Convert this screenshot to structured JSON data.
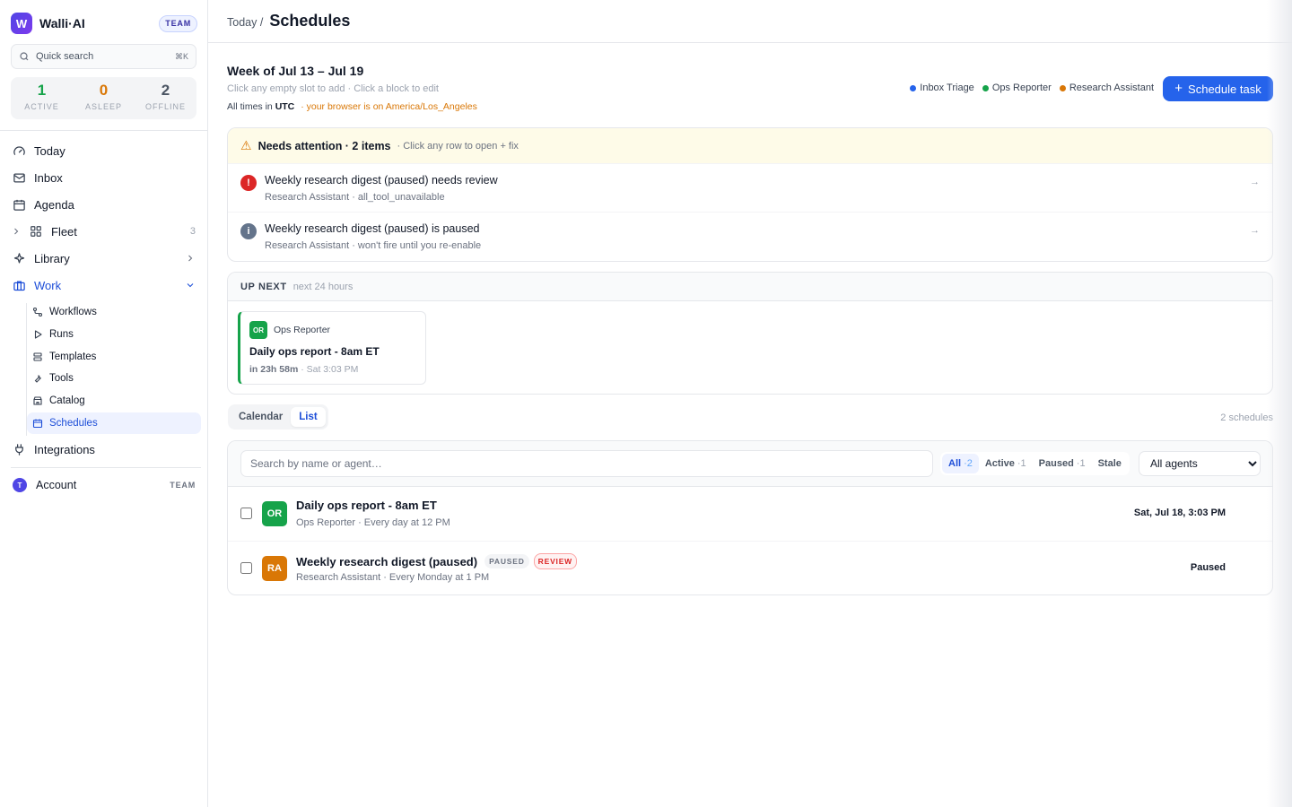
{
  "brand": {
    "logo": "W",
    "name": "Walli·AI",
    "plan": "TEAM"
  },
  "quick_search": {
    "placeholder": "Quick search",
    "shortcut": "⌘K"
  },
  "stats": [
    {
      "value": "1",
      "label": "ACTIVE",
      "color": "#16a34a"
    },
    {
      "value": "0",
      "label": "ASLEEP",
      "color": "#d97706"
    },
    {
      "value": "2",
      "label": "OFFLINE",
      "color": "#4b5563"
    }
  ],
  "nav": {
    "today": "Today",
    "inbox": "Inbox",
    "agenda": "Agenda",
    "fleet": "Fleet",
    "fleet_count": "3",
    "library": "Library",
    "work": "Work",
    "integrations": "Integrations",
    "work_items": [
      "Workflows",
      "Runs",
      "Templates",
      "Tools",
      "Catalog",
      "Schedules"
    ]
  },
  "account": {
    "initial": "T",
    "label": "Account",
    "plan": "TEAM"
  },
  "header": {
    "breadcrumb": "Today /",
    "title": "Schedules"
  },
  "week": {
    "title": "Week of Jul 13 – Jul 19",
    "hint": "Click any empty slot to add · Click a block to edit",
    "tz_prefix": "All times in",
    "tz": "UTC",
    "tz_warning": "· your browser is on America/Los_Angeles"
  },
  "legend": [
    {
      "name": "Inbox Triage",
      "color": "#2563eb"
    },
    {
      "name": "Ops Reporter",
      "color": "#16a34a"
    },
    {
      "name": "Research Assistant",
      "color": "#d97706"
    }
  ],
  "schedule_button": "Schedule task",
  "attention": {
    "title": "Needs attention · 2 items",
    "subtitle": "· Click any row to open + fix",
    "items": [
      {
        "title": "Weekly research digest (paused) needs review",
        "subtitle": "Research Assistant · all_tool_unavailable",
        "icon": "!",
        "color": "#dc2626",
        "arrow": "→"
      },
      {
        "title": "Weekly research digest (paused) is paused",
        "subtitle": "Research Assistant · won't fire until you re-enable",
        "icon": "i",
        "color": "#64748b",
        "arrow": "→"
      }
    ]
  },
  "up_next": {
    "title": "UP NEXT",
    "subtitle": "next 24 hours",
    "card": {
      "badge": "OR",
      "agent": "Ops Reporter",
      "title": "Daily ops report - 8am ET",
      "eta": "in 23h 58m",
      "when": "· Sat 3:03 PM"
    }
  },
  "view_tabs": {
    "calendar": "Calendar",
    "list": "List",
    "active": "List"
  },
  "schedules_count": "2 schedules",
  "filters": {
    "search_placeholder": "Search by name or agent…",
    "chips": [
      {
        "label": "All",
        "count": "·2"
      },
      {
        "label": "Active",
        "count": "·1"
      },
      {
        "label": "Paused",
        "count": "·1"
      },
      {
        "label": "Stale",
        "count": ""
      }
    ],
    "agent_select": "All agents"
  },
  "schedules": [
    {
      "badge": "OR",
      "color": "#16a34a",
      "name": "Daily ops report - 8am ET",
      "sub": "Ops Reporter · Every day at 12 PM",
      "next": "Sat, Jul 18, 3:03 PM"
    },
    {
      "badge": "RA",
      "color": "#d97706",
      "name": "Weekly research digest (paused)",
      "paused_badge": "PAUSED",
      "review_badge": "REVIEW",
      "sub": "Research Assistant · Every Monday at 1 PM",
      "next": "Paused"
    }
  ]
}
